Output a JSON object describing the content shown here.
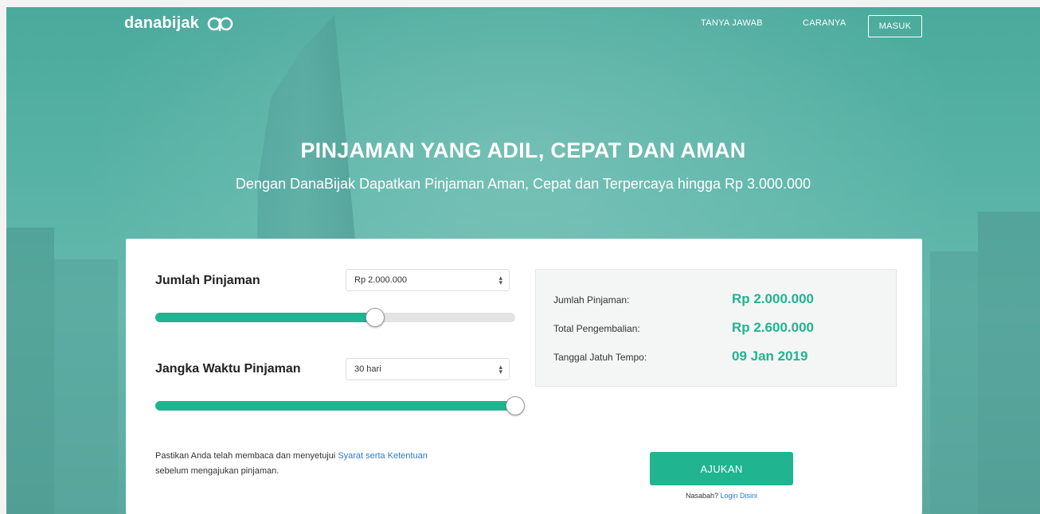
{
  "header": {
    "logo_text": "danabijak",
    "nav": [
      {
        "label": "TANYA JAWAB"
      },
      {
        "label": "CARANYA"
      }
    ],
    "login_label": "MASUK"
  },
  "hero": {
    "title": "PINJAMAN YANG ADIL, CEPAT DAN AMAN",
    "subtitle": "Dengan DanaBijak Dapatkan Pinjaman Aman, Cepat dan Terpercaya hingga Rp 3.000.000"
  },
  "form": {
    "amount": {
      "label": "Jumlah Pinjaman",
      "selected": "Rp 2.000.000",
      "slider_fraction": 0.61
    },
    "term": {
      "label": "Jangka Waktu Pinjaman",
      "selected": "30 hari",
      "slider_fraction": 1.0
    },
    "terms_text_before": "Pastikan Anda telah membaca dan menyetujui ",
    "terms_link": "Syarat serta Ketentuan",
    "terms_text_after": "sebelum mengajukan pinjaman.",
    "submit_label": "AJUKAN",
    "login_prompt": "Nasabah?",
    "login_link": "Login Disini"
  },
  "summary": {
    "rows": [
      {
        "label": "Jumlah Pinjaman:",
        "value": "Rp 2.000.000"
      },
      {
        "label": "Total Pengembalian:",
        "value": "Rp 2.600.000"
      },
      {
        "label": "Tanggal Jatuh Tempo:",
        "value": "09 Jan 2019"
      }
    ]
  },
  "colors": {
    "accent": "#20b491",
    "hero_bg": "#58b3a6",
    "link": "#2a7bd1"
  },
  "icons": {
    "logo_mark": "danabijak-logo-icon",
    "select_arrow": "chevron-updown-icon"
  }
}
